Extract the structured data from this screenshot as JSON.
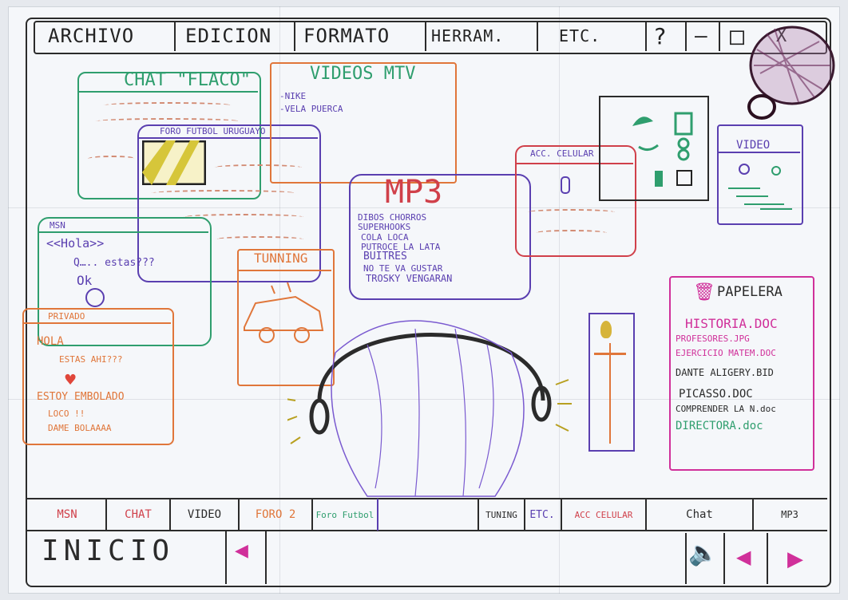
{
  "menu": {
    "archivo": "ARCHIVO",
    "edicion": "EDICION",
    "formato": "FORMATO",
    "herram": "HERRAM.",
    "etc": "ETC.",
    "help": "?",
    "minimize": "–",
    "maximize": "□",
    "close": "X"
  },
  "chat_window": {
    "title": "CHAT \"FLACO\""
  },
  "foro_window": {
    "title": "FORO FUTBOL URUGUAYO"
  },
  "videos_window": {
    "title": "VIDEOS MTV",
    "items": [
      "-NIKE",
      "-VELA PUERCA"
    ]
  },
  "mp3_window": {
    "title": "MP3",
    "items": [
      "DIBOS CHORROS",
      "SUPERHOOKS",
      "COLA LOCA",
      "PUTROCE LA LATA",
      "BUITRES",
      "NO TE VA GUSTAR",
      "TROSKY VENGARAN"
    ]
  },
  "msn_window": {
    "title": "MSN",
    "lines": [
      "<<Hola>>",
      "Q….. estas???",
      "Ok"
    ]
  },
  "tunning_window": {
    "title": "TUNNING"
  },
  "privado_window": {
    "title": "PRIVADO",
    "lines": [
      "HOLA",
      "ESTAS AHI???",
      "ESTOY EMBOLADO",
      "LOCO !!",
      "DAME BOLAAAA"
    ]
  },
  "acc_celular_window": {
    "title": "ACC. CELULAR"
  },
  "video_window": {
    "title": "VIDEO"
  },
  "papelera": {
    "title": "PAPELERA",
    "files": [
      "HISTORIA.DOC",
      "PROFESORES.JPG",
      "EJERCICIO MATEM.DOC",
      "DANTE ALIGERY.BID",
      "PICASSO.DOC",
      "COMPRENDER LA N.doc",
      "DIRECTORA.doc"
    ]
  },
  "taskbar": {
    "tabs_left": [
      "MSN",
      "CHAT",
      "VIDEO",
      "FORO 2",
      "Foro Futbol"
    ],
    "tabs_right": [
      "TUNING",
      "ETC.",
      "ACC CELULAR",
      "Chat",
      "MP3"
    ],
    "start_label": "INICIO"
  },
  "colors": {
    "frame": "#2b2b2b",
    "chat_green": "#2f9e6e",
    "purple": "#5a3fb0",
    "orange": "#e0763a",
    "red": "#d0404a",
    "pink": "#d0309a",
    "magenta": "#c0208a"
  }
}
